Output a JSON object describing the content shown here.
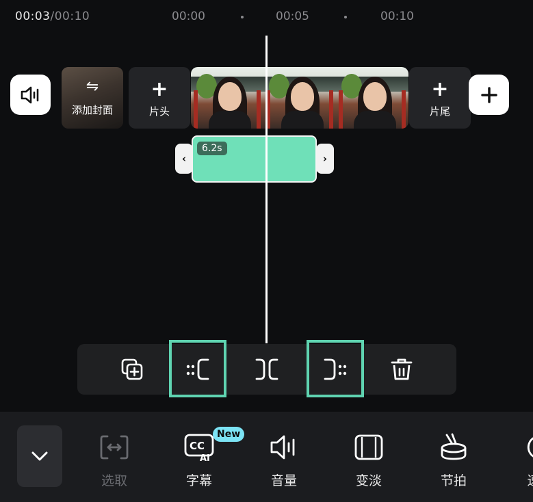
{
  "timeline": {
    "current": "00:03",
    "total": "/00:10",
    "ticks": [
      "00:00",
      "00:05",
      "00:10"
    ]
  },
  "track": {
    "cover_label": "添加封面",
    "intro_label": "片头",
    "outro_label": "片尾"
  },
  "clip": {
    "duration": "6.2s",
    "color": "#6fe0b8"
  },
  "edit_bar": {
    "highlight_color": "#5fd4b1",
    "tools": [
      "duplicate-icon",
      "trim-start-icon",
      "split-icon",
      "trim-end-icon",
      "delete-icon"
    ]
  },
  "toolbar": {
    "new_badge": "New",
    "tools": [
      {
        "label": "选取",
        "icon": "select-icon",
        "enabled": false
      },
      {
        "label": "字幕",
        "icon": "captions-ai-icon",
        "enabled": true
      },
      {
        "label": "音量",
        "icon": "volume-icon",
        "enabled": true
      },
      {
        "label": "变淡",
        "icon": "fade-icon",
        "enabled": true
      },
      {
        "label": "节拍",
        "icon": "beat-icon",
        "enabled": true
      },
      {
        "label": "速",
        "icon": "speed-icon",
        "enabled": true
      }
    ]
  }
}
